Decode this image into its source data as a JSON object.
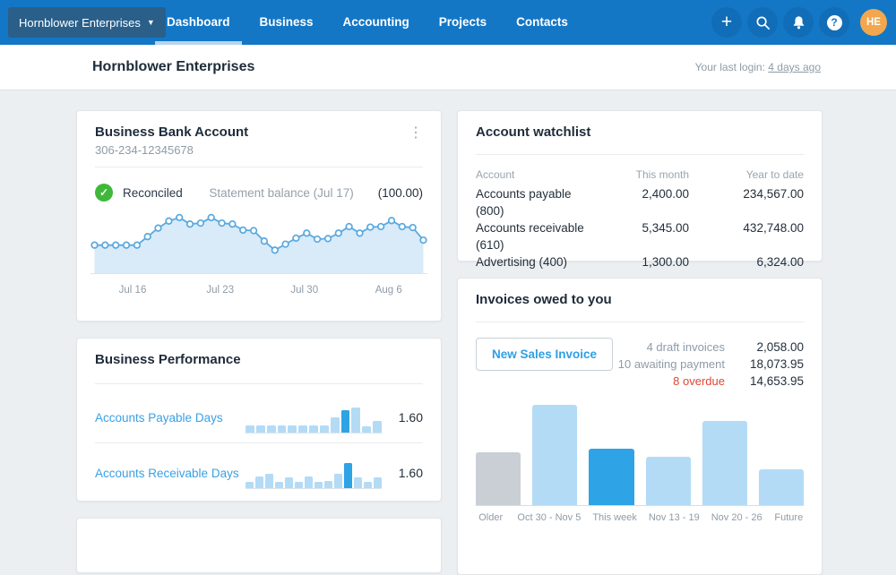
{
  "colors": {
    "nav_bg": "#1377C6",
    "org_box_bg": "#2A5F8A",
    "active_tab_underline": "#B9D4EA",
    "avatar_bg": "#F2A74E",
    "page_bg": "#ECEFF1",
    "heading_navy": "#1E2B39",
    "body_text": "#232F3B",
    "muted_text": "#8F9BA6",
    "link_blue": "#2E9FE6",
    "reconciled_green": "#3FB839",
    "overdue_red": "#E14632",
    "bar_light_blue": "#B3DBF6",
    "bar_dark_blue": "#2EA3E5",
    "bar_gray": "#C9CFD5"
  },
  "nav": {
    "org_selector": "Hornblower Enterprises",
    "items": [
      {
        "label": "Dashboard",
        "active": true
      },
      {
        "label": "Business",
        "active": false
      },
      {
        "label": "Accounting",
        "active": false
      },
      {
        "label": "Projects",
        "active": false
      },
      {
        "label": "Contacts",
        "active": false
      }
    ],
    "icons": [
      "plus-icon",
      "search-icon",
      "bell-icon",
      "help-icon"
    ],
    "plus_glyph": "+",
    "help_glyph": "?",
    "avatar_initials": "HE"
  },
  "header": {
    "title": "Hornblower Enterprises",
    "last_login_label": "Your last login:",
    "last_login_value": "4 days ago"
  },
  "bank_card": {
    "title": "Business Bank Account",
    "account_number": "306-234-12345678",
    "status": "Reconciled",
    "check_glyph": "✓",
    "kebab_glyph": "⋮",
    "statement_label": "Statement balance (Jul 17)",
    "statement_value": "(100.00)"
  },
  "watchlist": {
    "title": "Account watchlist",
    "columns": [
      "Account",
      "This month",
      "Year to date"
    ],
    "rows": [
      {
        "account": "Accounts payable (800)",
        "this_month": "2,400.00",
        "year_to_date": "234,567.00"
      },
      {
        "account": "Accounts receivable (610)",
        "this_month": "5,345.00",
        "year_to_date": "432,748.00"
      },
      {
        "account": "Advertising (400)",
        "this_month": "1,300.00",
        "year_to_date": "6,324.00"
      }
    ]
  },
  "performance": {
    "title": "Business Performance",
    "rows": [
      {
        "label": "Accounts Payable Days",
        "value": "1.60"
      },
      {
        "label": "Accounts Receivable Days",
        "value": "1.60"
      }
    ]
  },
  "invoices": {
    "title": "Invoices owed to you",
    "button_label": "New Sales Invoice",
    "stats": [
      {
        "label": "4 draft invoices",
        "value": "2,058.00",
        "status": "normal"
      },
      {
        "label": "10 awaiting payment",
        "value": "18,073.95",
        "status": "normal"
      },
      {
        "label": "8 overdue",
        "value": "14,653.95",
        "status": "overdue"
      }
    ]
  },
  "chart_data": [
    {
      "id": "bank_sparkline",
      "type": "area",
      "title": "Business Bank Account statement balance trend",
      "values": [
        38,
        38,
        38,
        38,
        38,
        55,
        72,
        86,
        93,
        80,
        82,
        93,
        82,
        80,
        68,
        67,
        46,
        28,
        40,
        52,
        62,
        50,
        51,
        62,
        75,
        62,
        74,
        75,
        87,
        75,
        73,
        48
      ],
      "x_tick_labels": [
        "Jul 16",
        "Jul 23",
        "Jul 30",
        "Aug 6"
      ],
      "x_tick_pos": [
        0.125,
        0.385,
        0.635,
        0.885
      ],
      "line_color": "#58A9DF",
      "fill_color": "#D9EAF8",
      "marker": "open-circle"
    },
    {
      "id": "payable_days",
      "type": "bar",
      "title": "Accounts Payable Days mini chart",
      "values": [
        1,
        1,
        1,
        1,
        1,
        1,
        1,
        1,
        2.2,
        3.3,
        3.7,
        0.9,
        1.7
      ],
      "highlight_index": 9,
      "bar_color": "#B3DBF6",
      "highlight_color": "#2EA3E5",
      "value_label": "1.60"
    },
    {
      "id": "receivable_days",
      "type": "bar",
      "title": "Accounts Receivable Days mini chart",
      "values": [
        0.8,
        1.6,
        1.9,
        0.9,
        1.5,
        0.8,
        1.6,
        0.9,
        1.0,
        2.0,
        3.4,
        1.5,
        0.8,
        1.4
      ],
      "highlight_index": 10,
      "bar_color": "#B3DBF6",
      "highlight_color": "#2EA3E5",
      "value_label": "1.60"
    },
    {
      "id": "invoices_owed",
      "type": "bar",
      "title": "Invoices owed to you by week",
      "categories": [
        "Older",
        "Oct 30 - Nov 5",
        "This week",
        "Nov 13 - 19",
        "Nov 20 - 26",
        "Future"
      ],
      "values": [
        53,
        100,
        56,
        48,
        84,
        36
      ],
      "ylim": [
        0,
        100
      ],
      "colors": [
        "#C9CFD5",
        "#B3DBF6",
        "#2EA3E5",
        "#B3DBF6",
        "#B3DBF6",
        "#B3DBF6"
      ],
      "grid": false
    }
  ]
}
